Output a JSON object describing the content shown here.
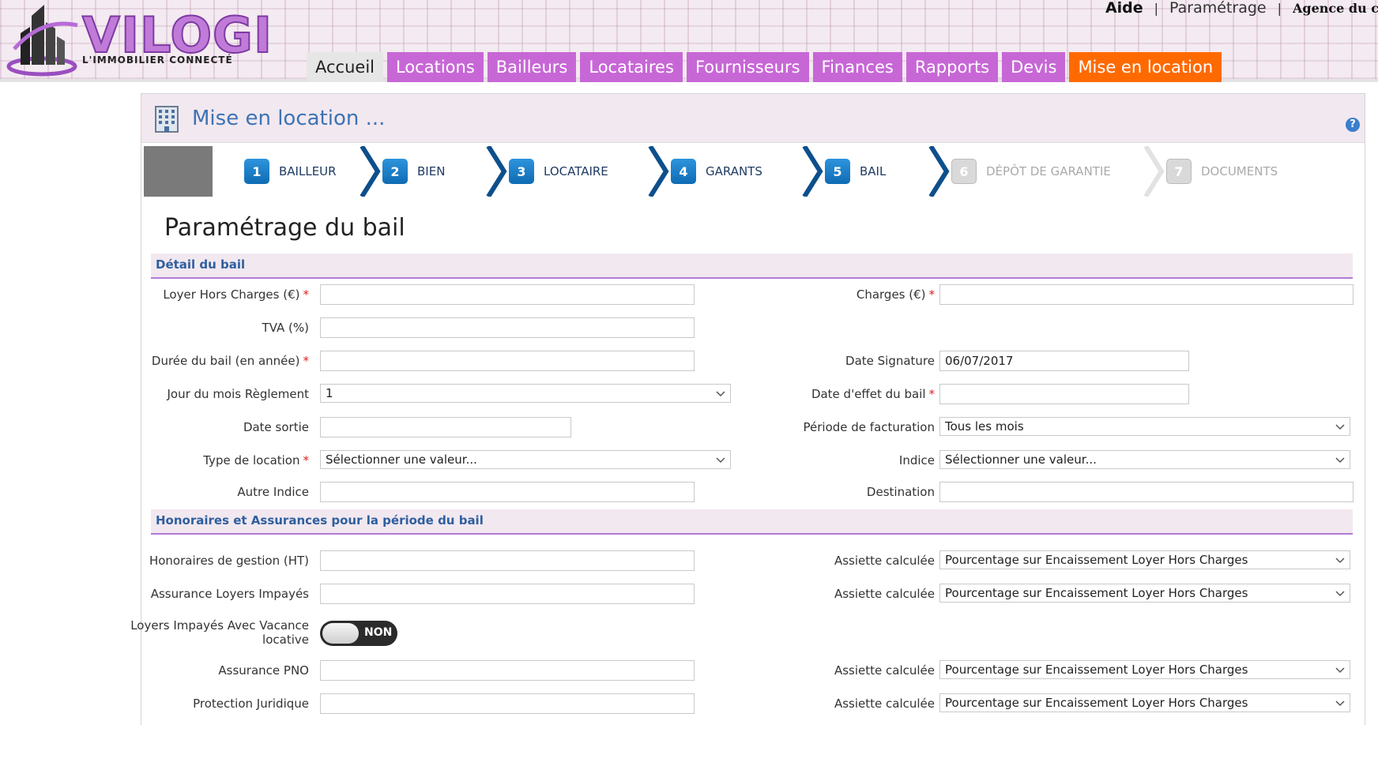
{
  "header": {
    "logo_text": "VILOGI",
    "logo_tagline": "L'IMMOBILIER CONNECTÉ",
    "top_links": {
      "aide": "Aide",
      "parametrage": "Paramétrage",
      "separator": "|",
      "agence": "Agence du coi"
    },
    "nav": [
      "Accueil",
      "Locations",
      "Bailleurs",
      "Locataires",
      "Fournisseurs",
      "Finances",
      "Rapports",
      "Devis",
      "Mise en location"
    ]
  },
  "panel": {
    "title": "Mise en location ...",
    "help": "?"
  },
  "wizard": {
    "steps": [
      {
        "num": "1",
        "label": "BAILLEUR"
      },
      {
        "num": "2",
        "label": "BIEN"
      },
      {
        "num": "3",
        "label": "LOCATAIRE"
      },
      {
        "num": "4",
        "label": "GARANTS"
      },
      {
        "num": "5",
        "label": "BAIL"
      },
      {
        "num": "6",
        "label": "DÉPÔT DE GARANTIE"
      },
      {
        "num": "7",
        "label": "DOCUMENTS"
      }
    ]
  },
  "form": {
    "title": "Paramétrage du bail",
    "required_mark": "*",
    "section1": "Détail du bail",
    "section2": "Honoraires et Assurances pour la période du bail",
    "loyer_hc": {
      "label": "Loyer Hors Charges (€)",
      "value": ""
    },
    "charges": {
      "label": "Charges (€)",
      "value": ""
    },
    "tva": {
      "label": "TVA (%)",
      "value": ""
    },
    "duree": {
      "label": "Durée du bail (en année)",
      "value": ""
    },
    "date_signature": {
      "label": "Date Signature",
      "value": "06/07/2017"
    },
    "jour_reglement": {
      "label": "Jour du mois Règlement",
      "value": "1"
    },
    "date_effet": {
      "label": "Date d'effet du bail",
      "value": ""
    },
    "date_sortie": {
      "label": "Date sortie",
      "value": ""
    },
    "periode_facturation": {
      "label": "Période de facturation",
      "value": "Tous les mois"
    },
    "type_location": {
      "label": "Type de location",
      "value": "Sélectionner une valeur..."
    },
    "indice": {
      "label": "Indice",
      "value": "Sélectionner une valeur..."
    },
    "autre_indice": {
      "label": "Autre Indice",
      "value": ""
    },
    "destination": {
      "label": "Destination",
      "value": ""
    },
    "honoraires": {
      "label": "Honoraires de gestion (HT)",
      "value": ""
    },
    "assurance_loyers": {
      "label": "Assurance Loyers Impayés",
      "value": ""
    },
    "vacance": {
      "label_line1": "Loyers Impayés Avec Vacance",
      "label_line2": "locative",
      "toggle": "NON"
    },
    "assurance_pno": {
      "label": "Assurance PNO",
      "value": ""
    },
    "protection": {
      "label": "Protection Juridique",
      "value": ""
    },
    "assiette_label": "Assiette calculée",
    "assiette_value": "Pourcentage sur Encaissement Loyer Hors Charges"
  }
}
